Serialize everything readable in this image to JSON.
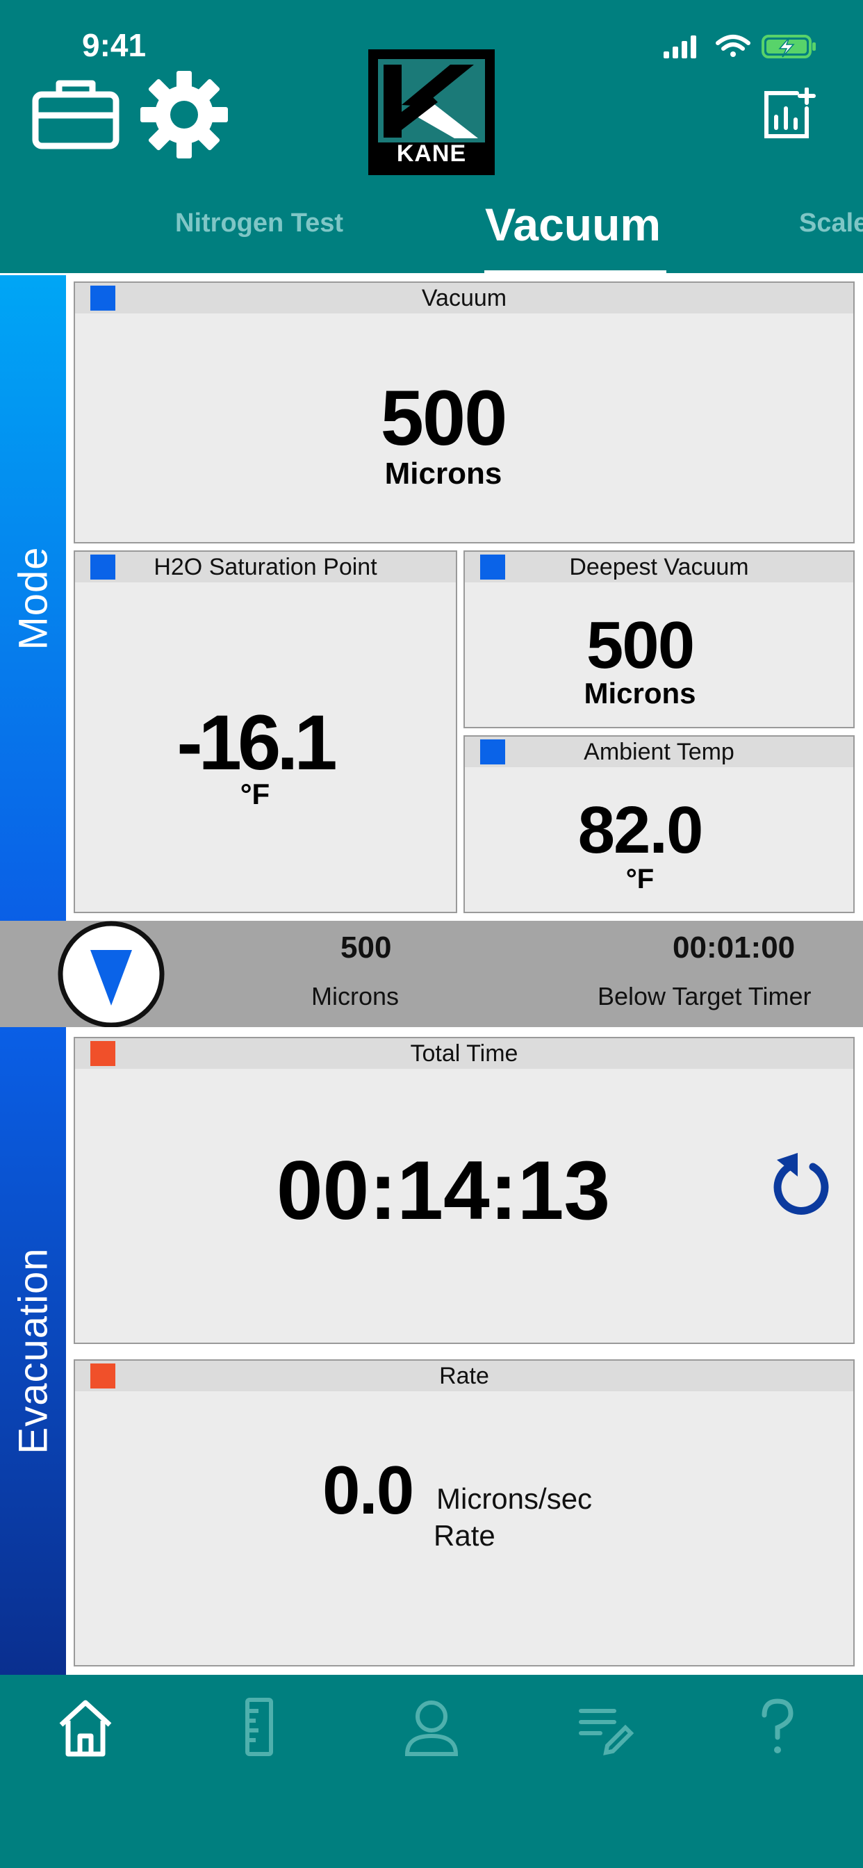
{
  "status_bar": {
    "time": "9:41"
  },
  "header": {
    "logo_text": "KANE",
    "tabs": [
      {
        "label": "Nitrogen Test",
        "active": false
      },
      {
        "label": "Vacuum",
        "active": true
      },
      {
        "label": "Scale",
        "active": false
      }
    ]
  },
  "side_labels": {
    "top": "Mode",
    "bottom": "Evacuation"
  },
  "cards": {
    "vacuum": {
      "title": "Vacuum",
      "value": "500",
      "unit": "Microns"
    },
    "h2o_saturation": {
      "title": "H2O Saturation Point",
      "value": "-16.1",
      "unit": "°F"
    },
    "deepest_vacuum": {
      "title": "Deepest Vacuum",
      "value": "500",
      "unit": "Microns"
    },
    "ambient_temp": {
      "title": "Ambient Temp",
      "value": "82.0",
      "unit": "°F"
    },
    "total_time": {
      "title": "Total Time",
      "value": "00:14:13"
    },
    "rate": {
      "title": "Rate",
      "value": "0.0",
      "unit": "Microns/sec",
      "sublabel": "Rate"
    }
  },
  "target_strip": {
    "target_value": "500",
    "target_unit": "Microns",
    "timer_value": "00:01:00",
    "timer_label": "Below Target Timer"
  },
  "colors": {
    "header_bg": "#007f7f",
    "mode_band_top": "#00a6f5",
    "mode_band_bottom": "#0a5fe6",
    "evac_band_top": "#0a5fe6",
    "evac_band_bottom": "#0a2f8f",
    "marker_blue": "#0a63e8",
    "marker_red": "#f0502a",
    "reset_icon": "#0b3a9e"
  },
  "icons": {
    "toolbox": "toolbox-icon",
    "settings": "gear-icon",
    "add_chart": "add-chart-icon",
    "target": "down-triangle-icon",
    "reset": "reset-icon",
    "nav": [
      "home-icon",
      "ruler-icon",
      "person-icon",
      "notes-icon",
      "help-icon"
    ]
  }
}
